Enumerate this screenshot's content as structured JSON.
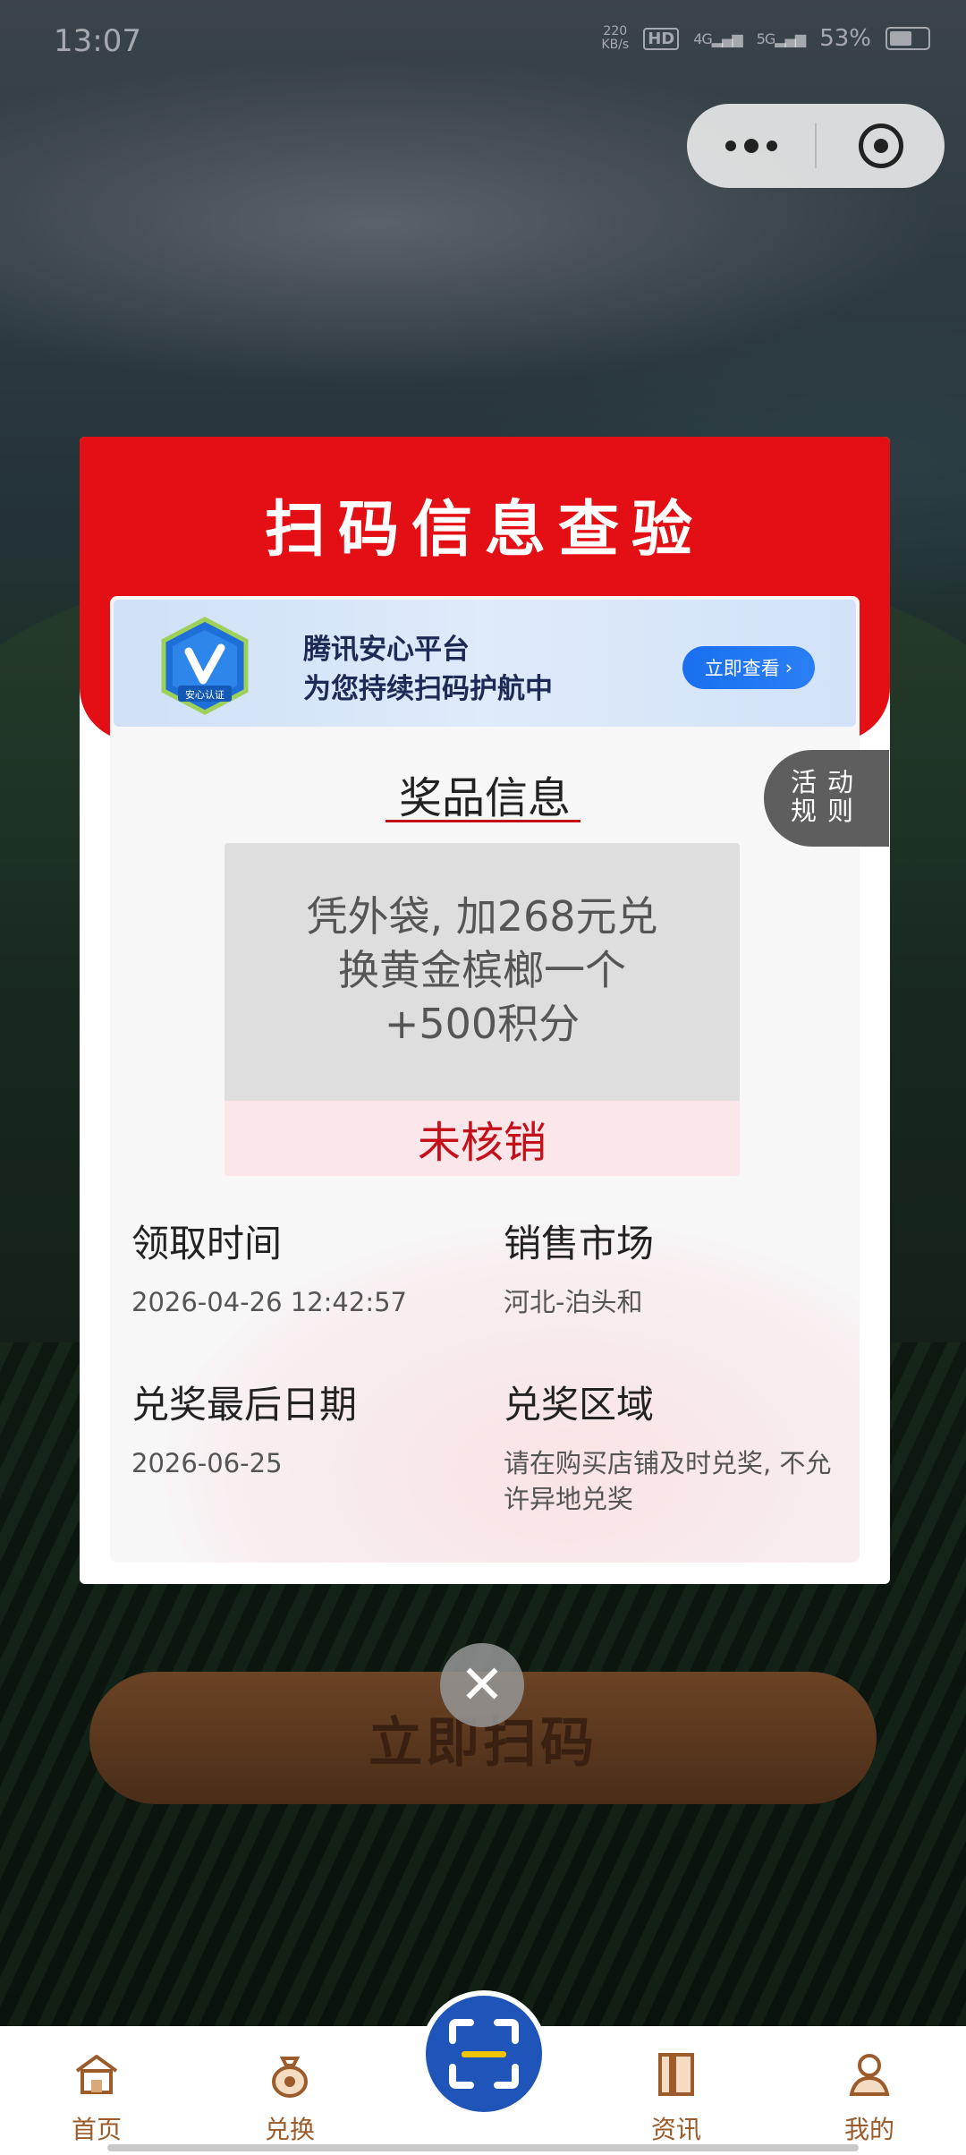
{
  "status_bar": {
    "time": "13:07",
    "net_speed": "220\nKB/s",
    "hd": "HD",
    "signal_1": "4G",
    "signal_2": "5G",
    "battery": "53%"
  },
  "scan_button": {
    "label": "立即扫码"
  },
  "modal": {
    "title": "扫码信息查验",
    "banner": {
      "badge_text": "安心认证",
      "line1": "腾讯安心平台",
      "line2": "为您持续扫码护航中",
      "action": "立即查看"
    },
    "section_title": "奖品信息",
    "prize_desc": [
      "凭外袋, 加268元兑",
      "换黄金槟榔一个",
      "+500积分"
    ],
    "prize_status": "未核销",
    "info": {
      "claim_time_label": "领取时间",
      "claim_time_value": "2026-04-26 12:42:57",
      "market_label": "销售市场",
      "market_value": "河北-泊头和",
      "deadline_label": "兑奖最后日期",
      "deadline_value": "2026-06-25",
      "region_label": "兑奖区域",
      "region_value": "请在购买店铺及时兑奖, 不允许异地兑奖"
    }
  },
  "rules_tab": {
    "line1": "活动",
    "line2": "规则"
  },
  "tabbar": {
    "home": "首页",
    "exchange": "兑换",
    "news": "资讯",
    "mine": "我的"
  },
  "colors": {
    "accent_red": "#e40f15",
    "tab_brown": "#9b5b2a",
    "scan_blue": "#1f54b8"
  }
}
